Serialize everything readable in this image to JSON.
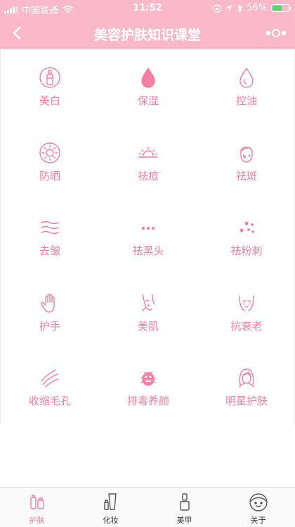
{
  "status_bar": {
    "carrier": "中国联通",
    "time": "11:52",
    "battery_percent": "56%",
    "battery_level": 0.56
  },
  "nav": {
    "title": "美容护肤知识课堂",
    "back_icon": "chevron-left-icon",
    "more_icon": "more-dots-icon"
  },
  "grid": {
    "items": [
      {
        "label": "美白",
        "icon": "bottle-icon"
      },
      {
        "label": "保湿",
        "icon": "water-drop-filled-icon"
      },
      {
        "label": "控油",
        "icon": "oil-drop-icon"
      },
      {
        "label": "防晒",
        "icon": "sun-icon"
      },
      {
        "label": "祛痘",
        "icon": "sunrise-icon"
      },
      {
        "label": "祛斑",
        "icon": "face-spots-icon"
      },
      {
        "label": "去皱",
        "icon": "wave-lines-icon"
      },
      {
        "label": "祛黑头",
        "icon": "dots-icon"
      },
      {
        "label": "祛粉刺",
        "icon": "scattered-dots-icon"
      },
      {
        "label": "护手",
        "icon": "hand-icon"
      },
      {
        "label": "美肌",
        "icon": "woman-face-icon"
      },
      {
        "label": "抗衰老",
        "icon": "aging-face-icon"
      },
      {
        "label": "收缩毛孔",
        "icon": "curved-lines-icon"
      },
      {
        "label": "排毒养颜",
        "icon": "bug-icon"
      },
      {
        "label": "明星护肤",
        "icon": "star-woman-icon"
      }
    ]
  },
  "tabbar": {
    "tabs": [
      {
        "label": "护肤",
        "icon": "skincare-bottles-icon",
        "active": true
      },
      {
        "label": "化妆",
        "icon": "makeup-tube-icon",
        "active": false
      },
      {
        "label": "美甲",
        "icon": "nail-polish-icon",
        "active": false
      },
      {
        "label": "关于",
        "icon": "profile-face-icon",
        "active": false
      }
    ]
  },
  "colors": {
    "bar_pink": "#f9b9c9",
    "accent_pink": "#f47fa0",
    "battery_green": "#4cd964"
  }
}
